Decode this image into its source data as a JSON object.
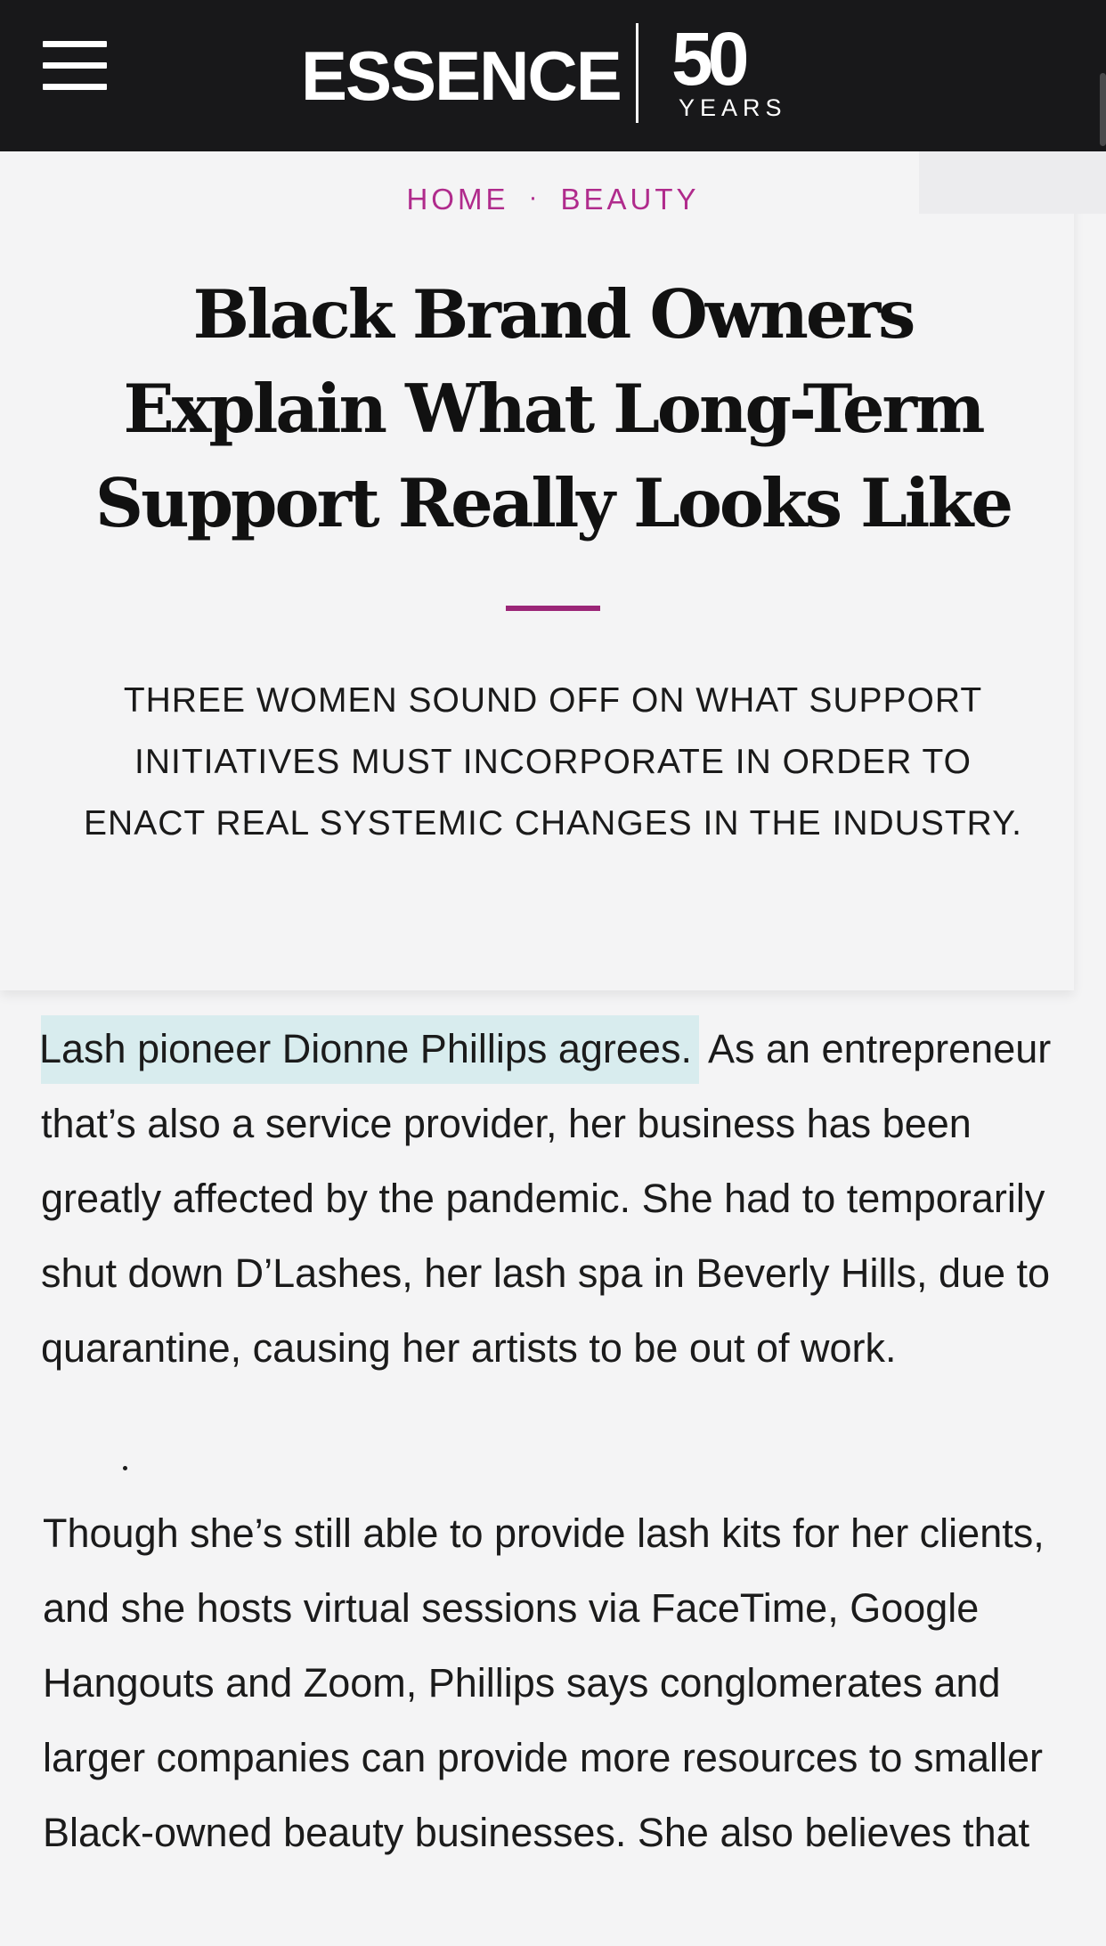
{
  "header": {
    "brand": "ESSENCE",
    "anniversary_number": "50",
    "anniversary_label": "YEARS",
    "menu_icon": "hamburger-menu-icon"
  },
  "breadcrumb": {
    "home": "HOME",
    "separator": "·",
    "section": "BEAUTY"
  },
  "article": {
    "headline": "Black Brand Owners Explain What Long-Term Support Really Looks Like",
    "dek": "THREE WOMEN SOUND OFF ON WHAT SUPPORT INITIATIVES MUST INCORPORATE IN ORDER TO ENACT REAL SYSTEMIC CHANGES IN THE INDUSTRY.",
    "paragraph1_highlight": "Lash pioneer Dionne Phillips agrees.",
    "paragraph1_rest": " As an entrepreneur that’s also a service provider, her business has been greatly affected by the pandemic. She had to temporarily shut down D’Lashes, her lash spa in Beverly Hills, due to quarantine, causing her artists to be out of work.",
    "paragraph2": "Though she’s still able to provide lash kits for her clients, and she hosts virtual sessions via FaceTime, Google Hangouts and Zoom, Phillips says conglomerates and larger companies can provide more resources to smaller Black-owned beauty businesses. She also believes that"
  },
  "colors": {
    "topbar": "#18181a",
    "accent": "#b02b8c",
    "highlight": "#d8ecee"
  }
}
